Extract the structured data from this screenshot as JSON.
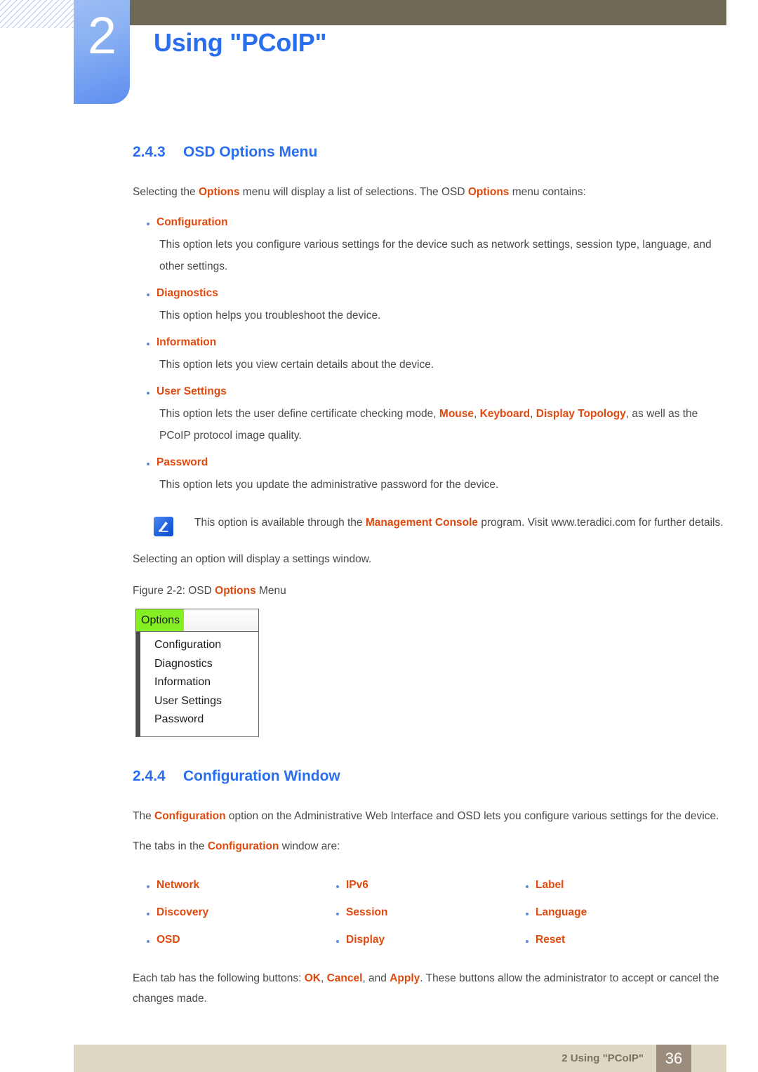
{
  "header": {
    "chapter_number": "2",
    "chapter_title": "Using \"PCoIP\""
  },
  "sections": {
    "osd_options": {
      "number": "2.4.3",
      "title": "OSD Options Menu",
      "intro_pre": "Selecting the ",
      "intro_kw1": "Options",
      "intro_mid": " menu will display a list of selections. The OSD ",
      "intro_kw2": "Options",
      "intro_post": " menu contains:",
      "features": [
        {
          "label": "Configuration",
          "desc": "This option lets you configure various settings for the device such as network settings, session type, language, and other settings."
        },
        {
          "label": "Diagnostics",
          "desc": "This option helps you troubleshoot the device."
        },
        {
          "label": "Information",
          "desc": "This option lets you view certain details about the device."
        },
        {
          "label": "User Settings",
          "desc_pre": "This option lets the user define certificate checking mode, ",
          "desc_kw1": "Mouse",
          "desc_sep1": ", ",
          "desc_kw2": "Keyboard",
          "desc_sep2": ", ",
          "desc_kw3": "Display Topology",
          "desc_post": ", as well as the PCoIP protocol image quality."
        },
        {
          "label": "Password",
          "desc": "This option lets you update the administrative password for the device."
        }
      ],
      "note": {
        "icon": "note-pen-icon",
        "pre": "This option is available through the ",
        "kw": "Management Console",
        "post": " program. Visit www.teradici.com for further details."
      },
      "after_note": "Selecting an option will display a settings window.",
      "figure_caption_pre": "Figure 2-2: OSD ",
      "figure_caption_kw": "Options",
      "figure_caption_post": " Menu",
      "osd_menu": {
        "tab_label": "Options",
        "items": [
          "Configuration",
          "Diagnostics",
          "Information",
          "User Settings",
          "Password"
        ]
      }
    },
    "config_window": {
      "number": "2.4.4",
      "title": "Configuration Window",
      "para1_pre": "The ",
      "para1_kw": "Configuration",
      "para1_post": " option on the Administrative Web Interface and OSD lets you configure various settings for the device.",
      "para2_pre": "The tabs in the ",
      "para2_kw": "Configuration",
      "para2_post": " window are:",
      "tab_columns": [
        [
          "Network",
          "Discovery",
          "OSD"
        ],
        [
          "IPv6",
          "Session",
          "Display"
        ],
        [
          "Label",
          "Language",
          "Reset"
        ]
      ],
      "para3_pre": "Each tab has the following buttons: ",
      "para3_kw1": "OK",
      "para3_sep1": ", ",
      "para3_kw2": "Cancel",
      "para3_sep2": ", and ",
      "para3_kw3": "Apply",
      "para3_post": ". These buttons allow the administrator to accept or cancel the changes made."
    }
  },
  "footer": {
    "label": "2 Using \"PCoIP\"",
    "page_number": "36"
  },
  "colors": {
    "heading_blue": "#2a6ef0",
    "keyword_orange": "#e0490d",
    "header_bar": "#6e6a55",
    "footer_bar": "#ded7c3",
    "footer_page_box": "#9a8d7e",
    "osd_tab_green": "#84f024"
  }
}
